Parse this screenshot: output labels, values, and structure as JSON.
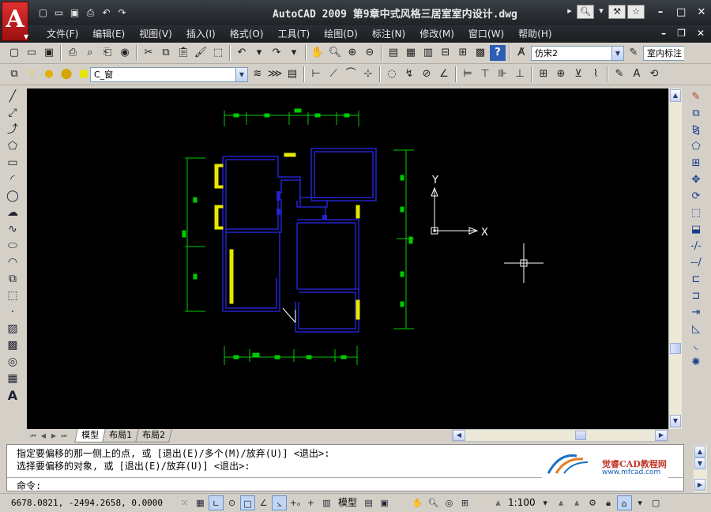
{
  "app": {
    "logo_letter": "A",
    "title": "AutoCAD 2009 第9章中式风格三居室室内设计.dwg"
  },
  "quick_access": [
    "□",
    "▭",
    "▣",
    "⎙",
    "↶",
    "↷"
  ],
  "infocenter": [
    "▸",
    "🔍",
    "☆"
  ],
  "menu": {
    "items": [
      "文件(F)",
      "编辑(E)",
      "视图(V)",
      "插入(I)",
      "格式(O)",
      "工具(T)",
      "绘图(D)",
      "标注(N)",
      "修改(M)",
      "窗口(W)",
      "帮助(H)"
    ]
  },
  "toolbar1": {
    "text_style": "仿宋2",
    "dim_style": "室内标注"
  },
  "toolbar2": {
    "layer": "C_窗"
  },
  "layout_tabs": [
    "模型",
    "布局1",
    "布局2"
  ],
  "command": {
    "history": [
      "指定要偏移的那一侧上的点, 或 [退出(E)/多个(M)/放弃(U)] <退出>:",
      "选择要偏移的对象, 或 [退出(E)/放弃(U)] <退出>:"
    ],
    "prompt": "命令:"
  },
  "watermark": {
    "title": "觉睿CAD教程网",
    "url": "www.mfcad.com"
  },
  "status": {
    "coords": "6678.0821, -2494.2658, 0.0000",
    "model_label": "模型",
    "annotation_scale": "1:100"
  },
  "ucs": {
    "x_label": "X",
    "y_label": "Y"
  },
  "colors": {
    "canvas_bg": "#000000",
    "wall": "#2222cc",
    "window": "#e6e600",
    "dimension": "#00cc00",
    "ucs": "#ffffff"
  }
}
